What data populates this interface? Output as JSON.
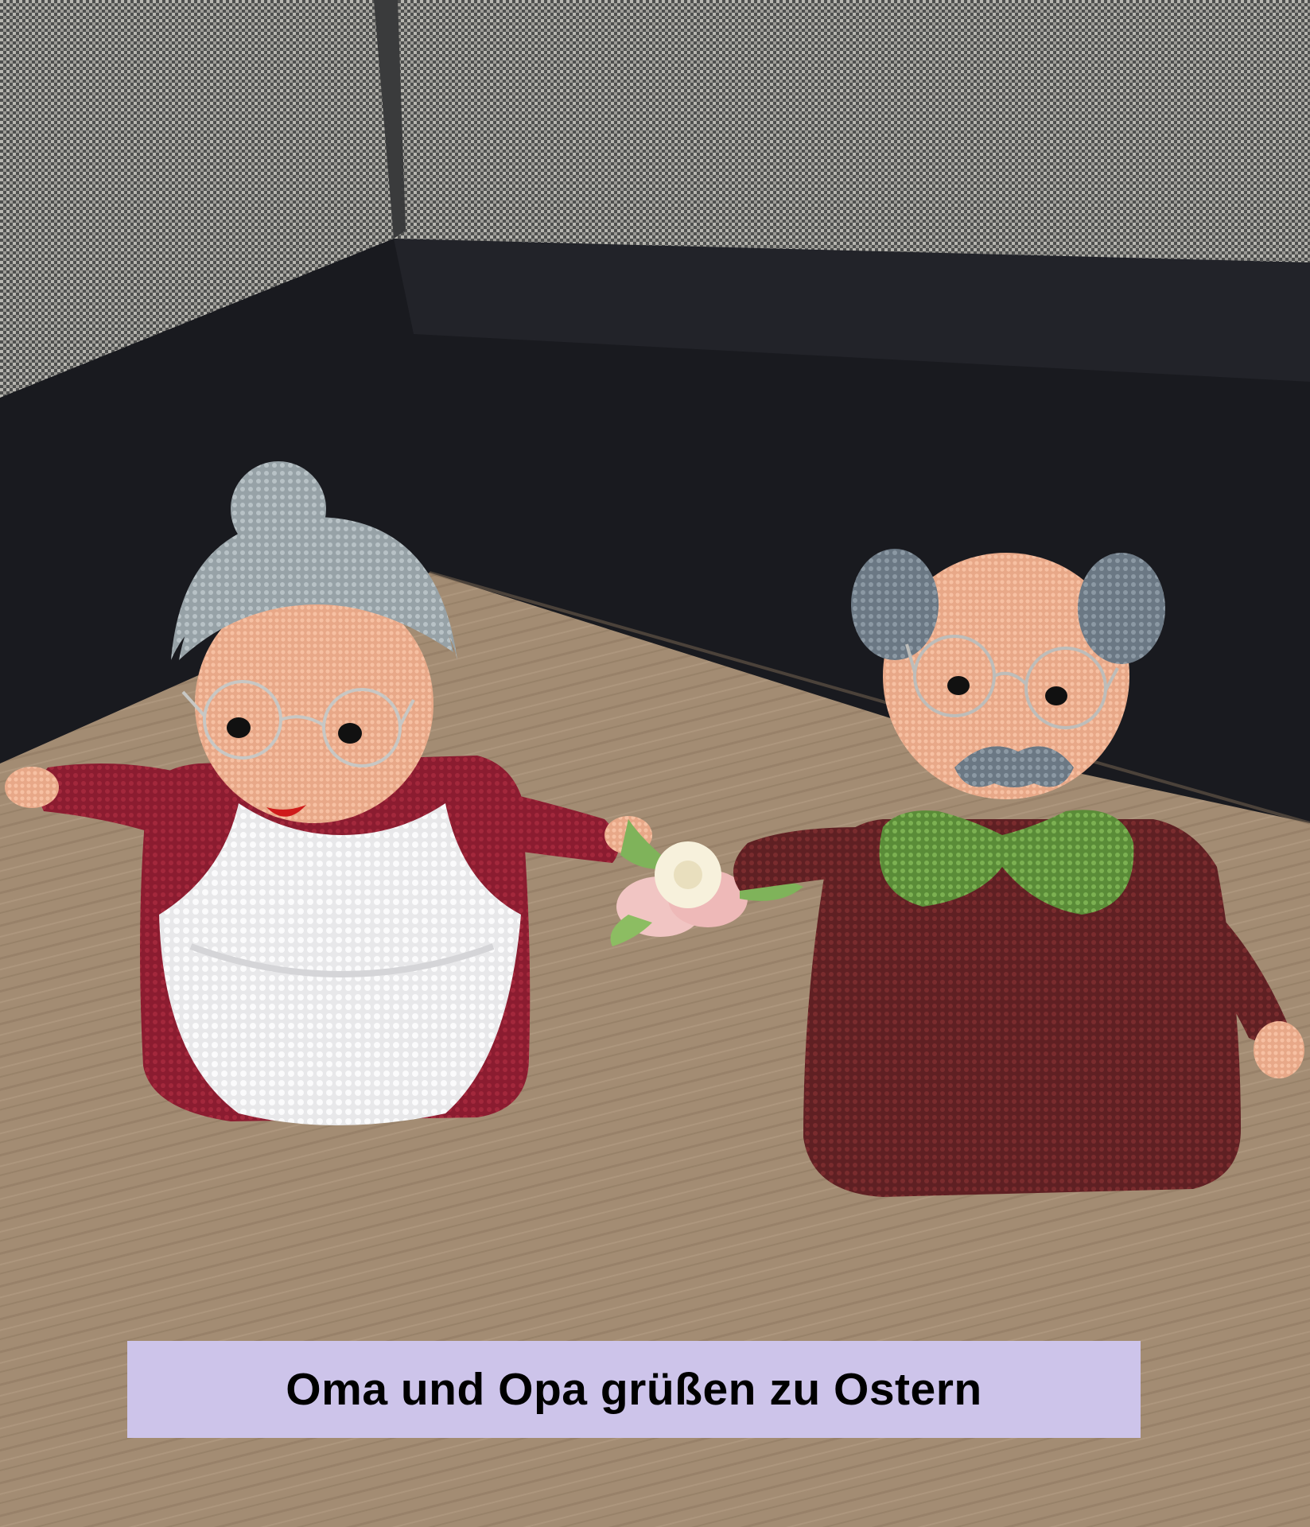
{
  "caption": {
    "text": "Oma und Opa grüßen zu Ostern",
    "background": "#cdc4ea",
    "color": "#000000"
  },
  "colors": {
    "sofa_fabric": "#8a8a86",
    "sofa_dark": "#1a1b20",
    "table_wood": "#a48d74",
    "oma_dress": "#8a1c30",
    "oma_apron": "#f3f3f4",
    "oma_hair": "#aab4b8",
    "opa_sweater": "#6e2628",
    "opa_bowtie": "#6ea04a",
    "opa_hair": "#7c8a96",
    "skin": "#f0b494"
  }
}
